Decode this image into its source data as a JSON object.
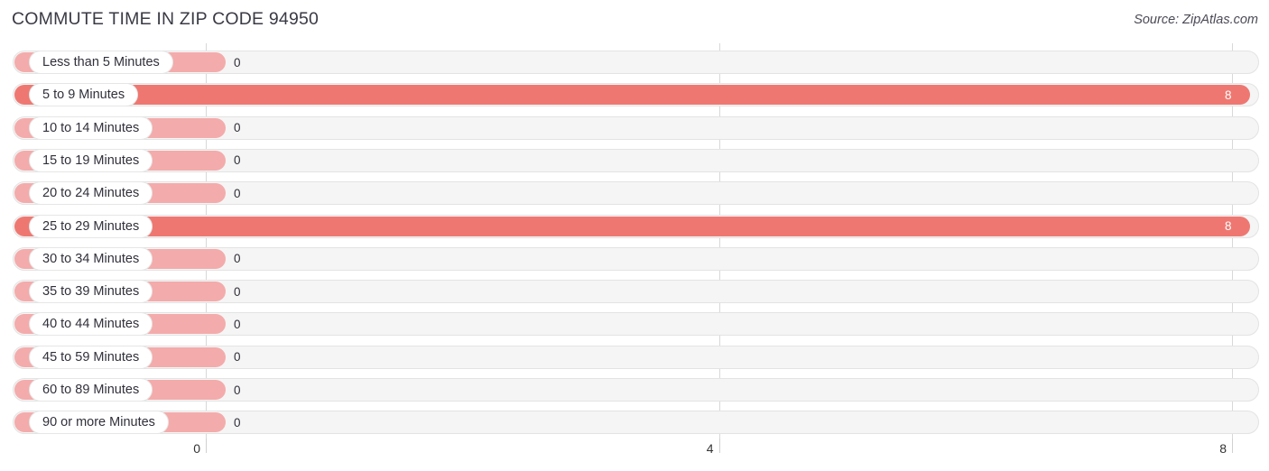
{
  "header": {
    "title": "COMMUTE TIME IN ZIP CODE 94950",
    "source": "Source: ZipAtlas.com"
  },
  "colors": {
    "bar_full": "#EE7871",
    "bar_zero": "#F4ABAB",
    "track": "#F5F5F5",
    "title_text": "#3A3A45"
  },
  "chart_data": {
    "type": "bar",
    "orientation": "horizontal",
    "title": "COMMUTE TIME IN ZIP CODE 94950",
    "xlabel": "",
    "ylabel": "",
    "xlim": [
      0,
      8
    ],
    "grid": true,
    "legend": null,
    "axis_ticks": [
      "0",
      "4",
      "8"
    ],
    "axis_tick_values": [
      0,
      4,
      8
    ],
    "categories": [
      "Less than 5 Minutes",
      "5 to 9 Minutes",
      "10 to 14 Minutes",
      "15 to 19 Minutes",
      "20 to 24 Minutes",
      "25 to 29 Minutes",
      "30 to 34 Minutes",
      "35 to 39 Minutes",
      "40 to 44 Minutes",
      "45 to 59 Minutes",
      "60 to 89 Minutes",
      "90 or more Minutes"
    ],
    "values": [
      0,
      8,
      0,
      0,
      0,
      8,
      0,
      0,
      0,
      0,
      0,
      0
    ],
    "value_labels": [
      "0",
      "8",
      "0",
      "0",
      "0",
      "8",
      "0",
      "0",
      "0",
      "0",
      "0",
      "0"
    ]
  },
  "rows": [
    {
      "label": "Less than 5 Minutes",
      "value": 0,
      "value_label": "0"
    },
    {
      "label": "5 to 9 Minutes",
      "value": 8,
      "value_label": "8"
    },
    {
      "label": "10 to 14 Minutes",
      "value": 0,
      "value_label": "0"
    },
    {
      "label": "15 to 19 Minutes",
      "value": 0,
      "value_label": "0"
    },
    {
      "label": "20 to 24 Minutes",
      "value": 0,
      "value_label": "0"
    },
    {
      "label": "25 to 29 Minutes",
      "value": 8,
      "value_label": "8"
    },
    {
      "label": "30 to 34 Minutes",
      "value": 0,
      "value_label": "0"
    },
    {
      "label": "35 to 39 Minutes",
      "value": 0,
      "value_label": "0"
    },
    {
      "label": "40 to 44 Minutes",
      "value": 0,
      "value_label": "0"
    },
    {
      "label": "45 to 59 Minutes",
      "value": 0,
      "value_label": "0"
    },
    {
      "label": "60 to 89 Minutes",
      "value": 0,
      "value_label": "0"
    },
    {
      "label": "90 or more Minutes",
      "value": 0,
      "value_label": "0"
    }
  ]
}
